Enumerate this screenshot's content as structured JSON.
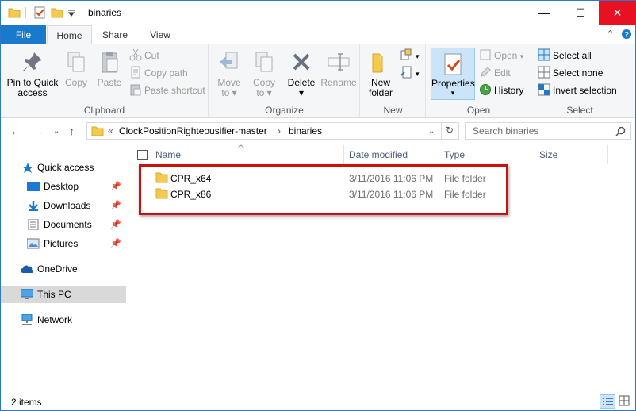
{
  "window": {
    "title": "binaries",
    "controls": {
      "minimize": "—",
      "maximize": "☐",
      "close": "✕"
    }
  },
  "ribbon_tabs": [
    "File",
    "Home",
    "Share",
    "View"
  ],
  "ribbon": {
    "clipboard": {
      "label": "Clipboard",
      "pin_to_quick_access": [
        "Pin to Quick",
        "access"
      ],
      "copy": "Copy",
      "paste": "Paste",
      "cut": "Cut",
      "copy_path": "Copy path",
      "paste_shortcut": "Paste shortcut"
    },
    "organize": {
      "label": "Organize",
      "move_to": [
        "Move",
        "to"
      ],
      "copy_to": [
        "Copy",
        "to"
      ],
      "delete": "Delete",
      "rename": "Rename"
    },
    "new": {
      "label": "New",
      "new_folder": [
        "New",
        "folder"
      ]
    },
    "open": {
      "label": "Open",
      "properties": "Properties",
      "open": "Open",
      "edit": "Edit",
      "history": "History"
    },
    "select": {
      "label": "Select",
      "select_all": "Select all",
      "select_none": "Select none",
      "invert_selection": "Invert selection"
    }
  },
  "address": {
    "overflow": "«",
    "segments": [
      "ClockPositionRighteousifier-master",
      "binaries"
    ],
    "separator": "›"
  },
  "search": {
    "placeholder": "Search binaries"
  },
  "nav_pane": {
    "quick_access": "Quick access",
    "items": [
      "Desktop",
      "Downloads",
      "Documents",
      "Pictures"
    ],
    "onedrive": "OneDrive",
    "this_pc": "This PC",
    "network": "Network"
  },
  "columns": [
    "Name",
    "Date modified",
    "Type",
    "Size"
  ],
  "files": [
    {
      "name": "CPR_x64",
      "date": "3/11/2016 11:06 PM",
      "type": "File folder",
      "size": ""
    },
    {
      "name": "CPR_x86",
      "date": "3/11/2016 11:06 PM",
      "type": "File folder",
      "size": ""
    }
  ],
  "status": {
    "item_count": "2 items"
  },
  "colors": {
    "accent": "#1979ca",
    "highlight_box": "#cc1010",
    "folder": "#f3c94f",
    "close": "#e81123"
  }
}
